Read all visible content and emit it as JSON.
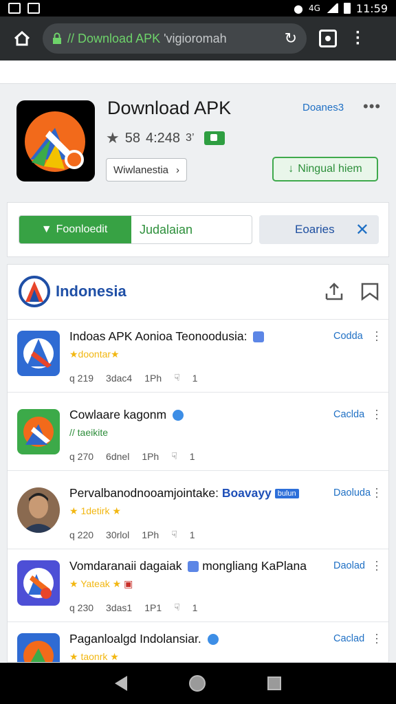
{
  "status_bar": {
    "time": "11:59",
    "carrier": "4G"
  },
  "browser": {
    "url_prefix": "//",
    "url_main": "Download APK",
    "url_rest": " 'vigioromah"
  },
  "header": {
    "title": "Download APK",
    "rating": "58",
    "rating_count": "4:248",
    "rating_extra": "3’",
    "region_button": "Wiwlanestia",
    "top_link": "Doanes3",
    "install_button": "Ningual hiem"
  },
  "filter": {
    "active_tab": "Foonloedit",
    "inactive_tab": "Judalaian",
    "search_chip": "Eoaries"
  },
  "list": {
    "brand": "Indonesia",
    "rows": [
      {
        "title": "Indoas APK Aonioa Teonoodusia:",
        "sub": "★doontar★",
        "meta1": "q 219",
        "meta2": "3dac4",
        "meta3": "1Ph",
        "meta4": "1",
        "link": "Codda"
      },
      {
        "title": "Cowlaare kagonm",
        "sub": "// taeikite",
        "meta1": "q 270",
        "meta2": "6dnel",
        "meta3": "1Ph",
        "meta4": "1",
        "link": "Caclda"
      },
      {
        "title": "Pervalbanodnooamjointake: ",
        "title_tag": "Boavayy",
        "title_pill": "bulun",
        "sub": "★ 1detirk ★",
        "meta1": "q 220",
        "meta2": "30rlol",
        "meta3": "1Ph",
        "meta4": "1",
        "link": "Daoluda"
      },
      {
        "title": "Vomdaranaii dagaiak",
        "title_after": "mongliang KaPlana",
        "sub": "★ Yateak ★",
        "meta1": "q 230",
        "meta2": "3das1",
        "meta3": "1P1",
        "meta4": "1",
        "link": "Daolad"
      },
      {
        "title": "Paganloalgd Indolansiar.",
        "sub": "★ taonrk ★",
        "meta1": "",
        "meta2": "",
        "meta3": "",
        "meta4": "",
        "link": "Caclad"
      }
    ]
  },
  "colors": {
    "brand_green": "#37a244",
    "link_blue": "#1e6fc4",
    "brand_blue": "#1f4fa6",
    "browser_bar": "#2a2d2f"
  }
}
